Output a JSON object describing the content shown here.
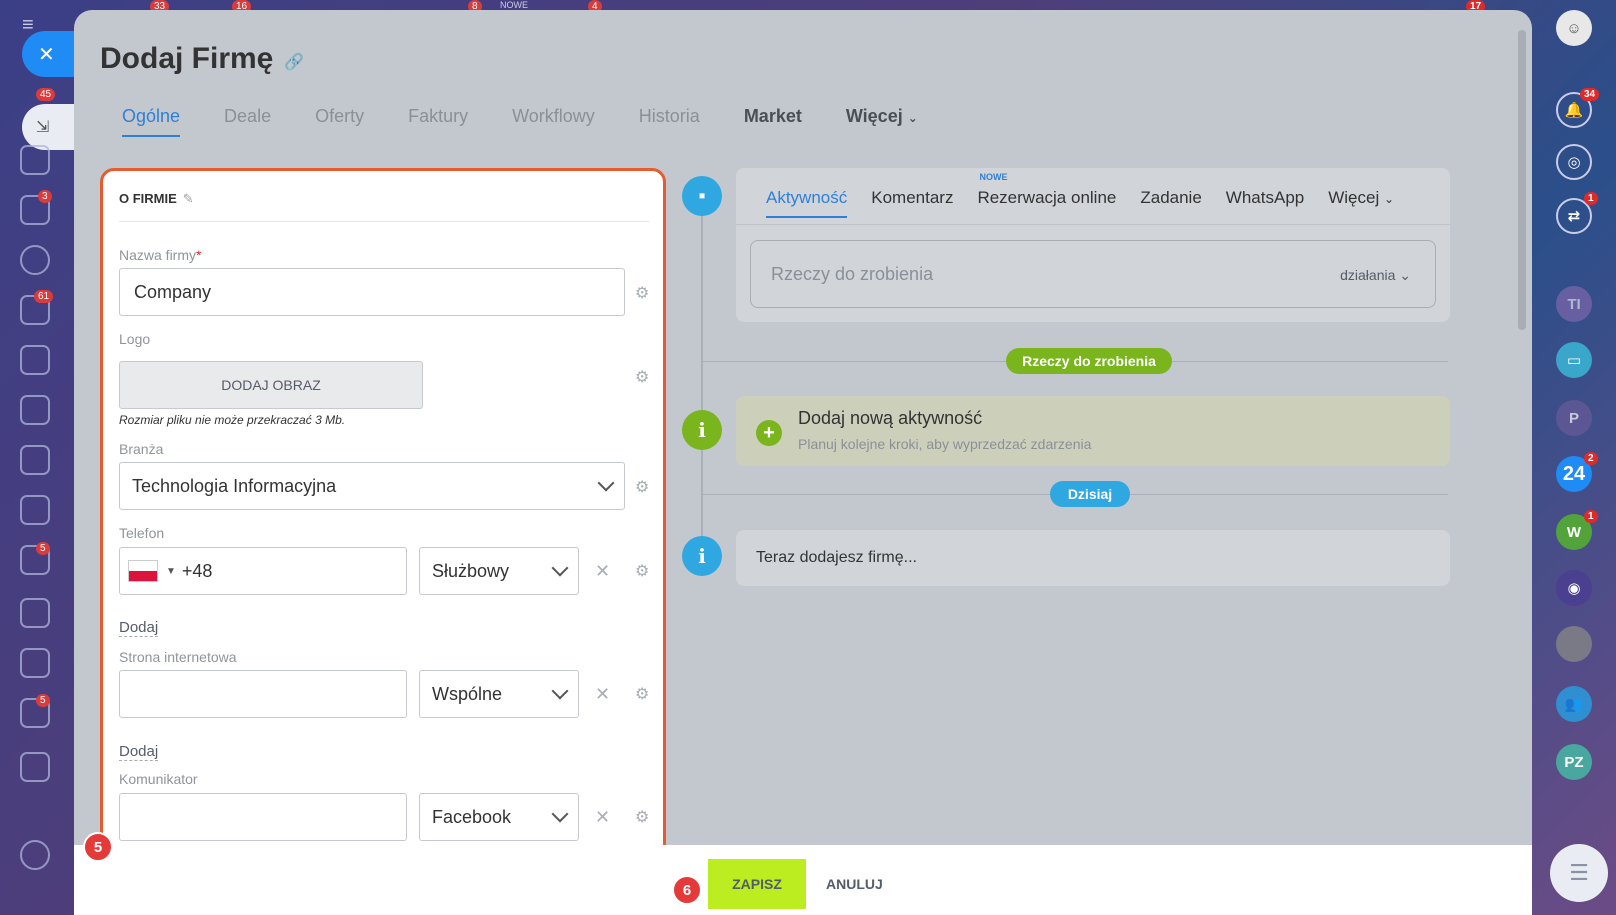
{
  "page": {
    "title": "Dodaj Firmę",
    "tabs": [
      {
        "label": "Ogólne",
        "active": true
      },
      {
        "label": "Deale"
      },
      {
        "label": "Oferty"
      },
      {
        "label": "Faktury"
      },
      {
        "label": "Workflowy"
      },
      {
        "label": "Historia"
      },
      {
        "label": "Market"
      },
      {
        "label": "Więcej"
      }
    ]
  },
  "form": {
    "section_title": "O FIRMIE",
    "company_name": {
      "label": "Nazwa firmy",
      "value": "Company"
    },
    "logo": {
      "label": "Logo",
      "button": "DODAJ OBRAZ",
      "hint": "Rozmiar pliku nie może przekraczać 3 Mb."
    },
    "industry": {
      "label": "Branża",
      "value": "Technologia Informacyjna"
    },
    "phone": {
      "label": "Telefon",
      "prefix": "+48",
      "type": "Służbowy",
      "add": "Dodaj"
    },
    "website": {
      "label": "Strona internetowa",
      "value": "",
      "type": "Wspólne",
      "add": "Dodaj"
    },
    "messenger": {
      "label": "Komunikator",
      "value": "",
      "type": "Facebook"
    }
  },
  "timeline": {
    "tabs": [
      {
        "label": "Aktywność",
        "active": true
      },
      {
        "label": "Komentarz"
      },
      {
        "label": "Rezerwacja online",
        "badge": "NOWE"
      },
      {
        "label": "Zadanie"
      },
      {
        "label": "WhatsApp"
      },
      {
        "label": "Więcej"
      }
    ],
    "todo_placeholder": "Rzeczy do zrobienia",
    "todo_action": "działania",
    "pill_todo": "Rzeczy do zrobienia",
    "new_activity_title": "Dodaj nową aktywność",
    "new_activity_sub": "Planuj kolejne kroki, aby wyprzedzać zdarzenia",
    "pill_today": "Dzisiaj",
    "info_text": "Teraz dodajesz firmę..."
  },
  "footer": {
    "save": "ZAPISZ",
    "cancel": "ANULUJ"
  },
  "markers": {
    "form": "5",
    "save": "6"
  },
  "left_badges": [
    "33",
    "16",
    "8",
    "NOWE",
    "4",
    "45",
    "3",
    "61",
    "5",
    "5"
  ],
  "right_badges": {
    "notifications": "34",
    "chat": "1",
    "b24": "2",
    "w": "1",
    "top": "17"
  },
  "right_avatars": {
    "ti": "TI",
    "p": "P",
    "b24": "24",
    "w": "W",
    "pz": "PZ"
  },
  "colors": {
    "accent": "#2f7fd6",
    "save": "#bbed21",
    "highlight": "#e65c2e",
    "green": "#7ab51d",
    "blue_pill": "#2fa7e0"
  }
}
